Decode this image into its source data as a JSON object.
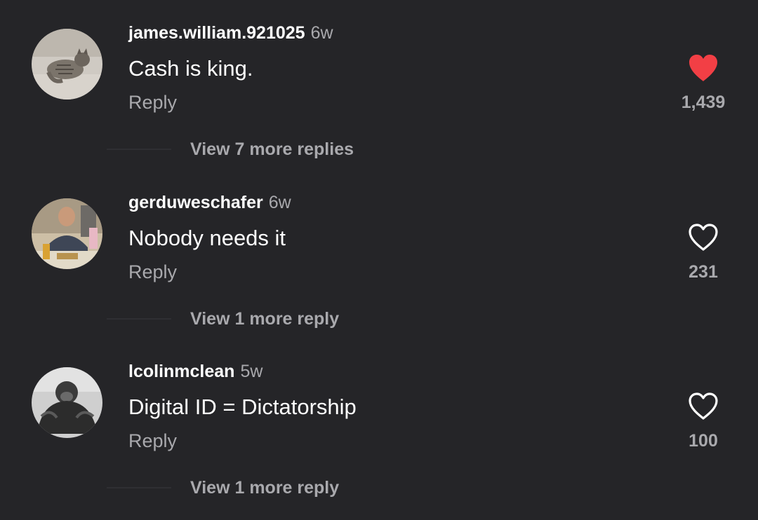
{
  "colors": {
    "background": "#252528",
    "primary_text": "#ffffff",
    "secondary_text": "#a9a9ad",
    "liked_heart": "#f23f45"
  },
  "comments": [
    {
      "username": "james.william.921025",
      "age": "6w",
      "text": "Cash is king.",
      "reply_label": "Reply",
      "like_count": "1,439",
      "liked": true,
      "heart_icon": "heart-filled-icon",
      "view_more_label": "View 7 more replies",
      "avatar": "cat-avatar"
    },
    {
      "username": "gerduweschafer",
      "age": "6w",
      "text": "Nobody needs it",
      "reply_label": "Reply",
      "like_count": "231",
      "liked": false,
      "heart_icon": "heart-outline-icon",
      "view_more_label": "View 1 more reply",
      "avatar": "man-avatar"
    },
    {
      "username": "lcolinmclean",
      "age": "5w",
      "text": "Digital ID = Dictatorship",
      "reply_label": "Reply",
      "like_count": "100",
      "liked": false,
      "heart_icon": "heart-outline-icon",
      "view_more_label": "View 1 more reply",
      "avatar": "gorilla-avatar"
    }
  ]
}
